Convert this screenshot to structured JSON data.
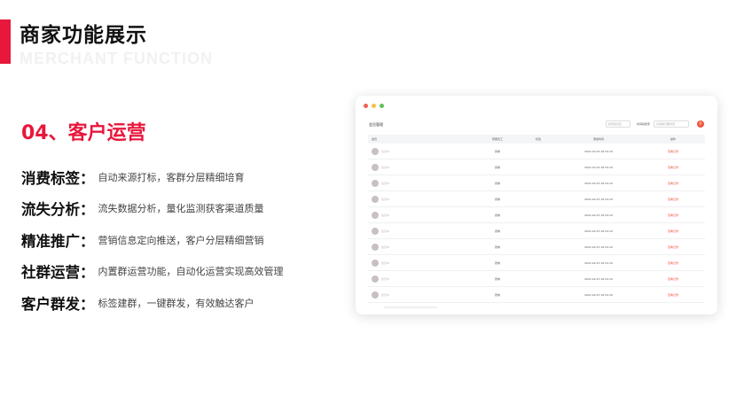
{
  "slide": {
    "title": "商家功能展示",
    "subtitle": "MERCHANT FUNCTION",
    "accent_color": "#e8173c"
  },
  "section": {
    "title": "04、客户运营"
  },
  "features": [
    {
      "name": "消费标签",
      "colon": "：",
      "desc": "自动来源打标，客群分层精细培育"
    },
    {
      "name": "流失分析",
      "colon": "：",
      "desc": "流失数据分析，量化监测获客渠道质量"
    },
    {
      "name": "精准推广",
      "colon": "：",
      "desc": "营销信息定向推送，客户分层精细营销"
    },
    {
      "name": "社群运营",
      "colon": "：",
      "desc": "内置群运营功能，自动化运营实现高效管理"
    },
    {
      "name": "客户群发",
      "colon": "：",
      "desc": "标签建群，一键群发，有效触达客户"
    }
  ],
  "window": {
    "title": "会员管理",
    "search_placeholder": "搜索会员名",
    "time_label": "时间段搜索",
    "time_placeholder": "请选择日期时间",
    "search_icon": "search-icon",
    "columns": [
      "会员",
      "所属员工",
      "标签",
      "添加时间",
      "操作"
    ],
    "rows": [
      {
        "member": "会员ID",
        "staff": "张棉",
        "tag": "",
        "time": "2022-02-23 16:34:10",
        "action": "查看记录"
      },
      {
        "member": "会员ID",
        "staff": "张棉",
        "tag": "",
        "time": "2022-02-23 16:34:10",
        "action": "查看记录"
      },
      {
        "member": "会员ID",
        "staff": "张棉",
        "tag": "",
        "time": "2022-02-23 16:34:10",
        "action": "查看记录"
      },
      {
        "member": "会员ID",
        "staff": "张棉",
        "tag": "",
        "time": "2022-02-23 16:34:10",
        "action": "查看记录"
      },
      {
        "member": "会员ID",
        "staff": "张棉",
        "tag": "",
        "time": "2022-02-23 16:34:10",
        "action": "查看记录"
      },
      {
        "member": "会员ID",
        "staff": "张棉",
        "tag": "",
        "time": "2022-02-23 16:34:10",
        "action": "查看记录"
      },
      {
        "member": "会员ID",
        "staff": "张棉",
        "tag": "",
        "time": "2022-02-23 16:34:10",
        "action": "查看记录"
      },
      {
        "member": "会员ID",
        "staff": "张棉",
        "tag": "",
        "time": "2022-02-23 16:34:10",
        "action": "查看记录"
      },
      {
        "member": "会员ID",
        "staff": "张棉",
        "tag": "",
        "time": "2022-02-23 16:34:10",
        "action": "查看记录"
      },
      {
        "member": "会员ID",
        "staff": "张棉",
        "tag": "",
        "time": "2022-02-23 16:34:10",
        "action": "查看记录"
      }
    ]
  }
}
